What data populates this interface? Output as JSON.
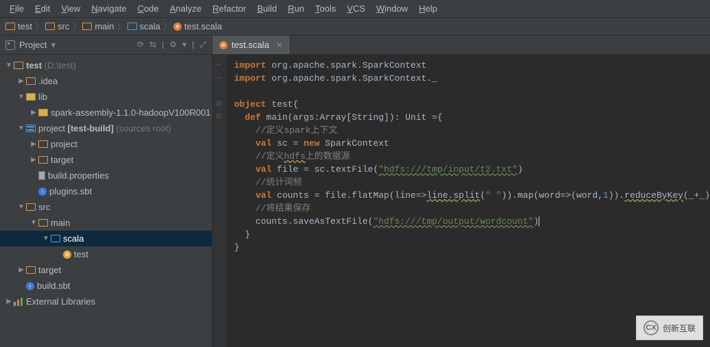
{
  "menu": [
    "File",
    "Edit",
    "View",
    "Navigate",
    "Code",
    "Analyze",
    "Refactor",
    "Build",
    "Run",
    "Tools",
    "VCS",
    "Window",
    "Help"
  ],
  "breadcrumbs": {
    "items": [
      {
        "icon": "folder-orange",
        "label": "test"
      },
      {
        "icon": "folder-orange",
        "label": "src"
      },
      {
        "icon": "folder-orange",
        "label": "main"
      },
      {
        "icon": "folder-blue",
        "label": "scala"
      },
      {
        "icon": "scala-file",
        "label": "test.scala"
      }
    ]
  },
  "sidebar": {
    "title": "Project",
    "tools": [
      "⟳",
      "⇆",
      "|",
      "⚙",
      "▾",
      "|",
      "⤢"
    ],
    "tree": [
      {
        "depth": 0,
        "arrow": "down",
        "icon": "folder-orange",
        "label": "test",
        "suffix": " (D:\\test)"
      },
      {
        "depth": 1,
        "arrow": "right",
        "icon": "folder-orange",
        "label": ".idea"
      },
      {
        "depth": 1,
        "arrow": "down",
        "icon": "lib",
        "label": "lib"
      },
      {
        "depth": 2,
        "arrow": "right",
        "icon": "lib",
        "label": "spark-assembly-1.1.0-hadoopV100R001"
      },
      {
        "depth": 1,
        "arrow": "down",
        "icon": "src",
        "label": "project [test-build]",
        "suffix": " (sources root)",
        "boldPart": "[test-build]"
      },
      {
        "depth": 2,
        "arrow": "right",
        "icon": "folder-orange",
        "label": "project"
      },
      {
        "depth": 2,
        "arrow": "right",
        "icon": "folder-orange",
        "label": "target"
      },
      {
        "depth": 2,
        "arrow": "none",
        "icon": "file",
        "label": "build.properties"
      },
      {
        "depth": 2,
        "arrow": "none",
        "icon": "sbt",
        "label": "plugins.sbt"
      },
      {
        "depth": 1,
        "arrow": "down",
        "icon": "folder-orange",
        "label": "src"
      },
      {
        "depth": 2,
        "arrow": "down",
        "icon": "folder-orange",
        "label": "main"
      },
      {
        "depth": 3,
        "arrow": "down",
        "icon": "folder-blue",
        "label": "scala",
        "selected": true
      },
      {
        "depth": 4,
        "arrow": "none",
        "icon": "scala-obj",
        "label": "test"
      },
      {
        "depth": 1,
        "arrow": "right",
        "icon": "folder-orange",
        "label": "target"
      },
      {
        "depth": 1,
        "arrow": "none",
        "icon": "sbt",
        "label": "build.sbt"
      },
      {
        "depth": 0,
        "arrow": "right",
        "icon": "ext",
        "label": "External Libraries"
      }
    ]
  },
  "tabs": {
    "active": "test.scala"
  },
  "code": {
    "lines": [
      {
        "t": "import",
        "r": " org.apache.spark.SparkContext"
      },
      {
        "t": "import",
        "r": " org.apache.spark.SparkContext._"
      },
      {
        "blank": true
      },
      {
        "t": "object",
        "r": " test{"
      },
      {
        "indent": 1,
        "t": "def",
        "sig": " main(args:Array[",
        "type": "String",
        "sig2": "]): Unit ={"
      },
      {
        "indent": 2,
        "cmt": "//定义spark上下文"
      },
      {
        "indent": 2,
        "val": "val",
        "r1": " sc = ",
        "new": "new",
        "r2": " SparkContext"
      },
      {
        "indent": 2,
        "cmt": "//定义hdfs上的数据源",
        "cmtWarn": "hdfs"
      },
      {
        "indent": 2,
        "val": "val",
        "r1": " file = sc.textFile(",
        "str": "\"hdfs:///tmp/input/t2.txt\"",
        "r2": ")"
      },
      {
        "indent": 2,
        "cmt": "//统计词频"
      },
      {
        "indent": 2,
        "val": "val",
        "r1": " counts = file.flatMap(line=>",
        "u1": "line.split",
        "r2": "(",
        "str": "\" \"",
        "r3": ")).map(word=>(word,",
        "num": "1",
        "r4": ")).",
        "u2": "reduceByKey",
        "r5": "(_+_)"
      },
      {
        "indent": 2,
        "cmt": "//将结果保存"
      },
      {
        "indent": 2,
        "plain": "counts.saveAsTextFile(",
        "str": "\"hdfs:///tmp/output/wordcount\"",
        "r2": ")",
        "caret": true
      },
      {
        "indent": 1,
        "plain": "}"
      },
      {
        "plain": "}"
      }
    ]
  },
  "watermark": {
    "logo": "CX",
    "text": "创新互联"
  }
}
